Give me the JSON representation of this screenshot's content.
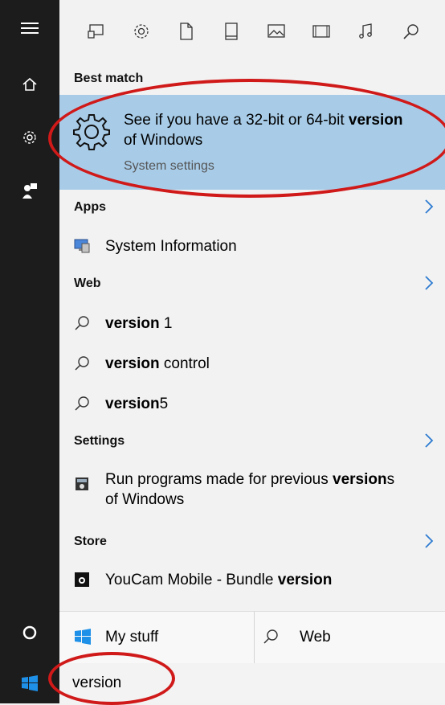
{
  "sidebar": {
    "items": [
      {
        "icon": "hamburger-menu-icon"
      },
      {
        "icon": "home-icon"
      },
      {
        "icon": "gear-icon"
      },
      {
        "icon": "feedback-person-icon"
      },
      {
        "icon": "cortana-circle-icon"
      },
      {
        "icon": "windows-start-icon"
      }
    ]
  },
  "toolbar": {
    "icons": [
      "apps-icon",
      "settings-gear-icon",
      "document-icon",
      "tablet-icon",
      "photos-icon",
      "videos-icon",
      "music-icon",
      "search-icon"
    ]
  },
  "sections": {
    "best_match": "Best match",
    "apps": "Apps",
    "web": "Web",
    "settings": "Settings",
    "store": "Store"
  },
  "best_match": {
    "title_pre": "See if you have a 32-bit or 64-bit ",
    "title_bold": "version",
    "title_post": "of Windows",
    "subtitle": "System settings"
  },
  "apps": [
    {
      "label": "System Information",
      "icon": "system-information-icon"
    }
  ],
  "web": [
    {
      "bold": "version",
      "rest": " 1"
    },
    {
      "bold": "version",
      "rest": " control"
    },
    {
      "bold": "version",
      "rest": "5"
    }
  ],
  "settings": [
    {
      "line1_pre": "Run programs made for previous ",
      "line1_bold": "version",
      "line1_post": "s",
      "line2": "of Windows",
      "icon": "compatibility-icon"
    }
  ],
  "store": [
    {
      "pre": "YouCam Mobile - Bundle ",
      "bold": "version",
      "icon": "camera-app-icon"
    }
  ],
  "bottom": {
    "my_stuff": "My stuff",
    "web": "Web"
  },
  "search": {
    "value": "version"
  },
  "colors": {
    "highlight": "#a8cce8",
    "accent": "#2d7bd1",
    "annotation": "#d01919",
    "sidebar": "#1c1c1c"
  }
}
